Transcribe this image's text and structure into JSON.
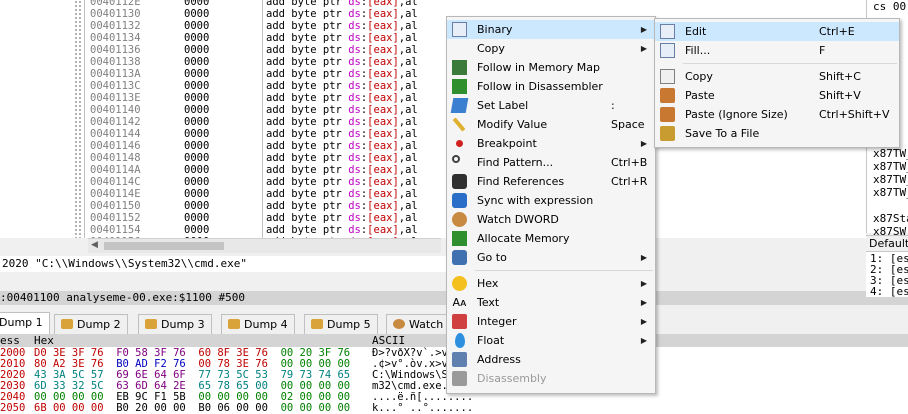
{
  "disasm": {
    "rows": [
      {
        "addr": "0040112E",
        "bytes": "0000",
        "op": "add byte ptr ",
        "seg": "ds",
        "reg": "[eax]",
        "tail": ",al"
      },
      {
        "addr": "00401130",
        "bytes": "0000",
        "op": "add byte ptr ",
        "seg": "ds",
        "reg": "[eax]",
        "tail": ",al"
      },
      {
        "addr": "00401132",
        "bytes": "0000",
        "op": "add byte ptr ",
        "seg": "ds",
        "reg": "[eax]",
        "tail": ",al"
      },
      {
        "addr": "00401134",
        "bytes": "0000",
        "op": "add byte ptr ",
        "seg": "ds",
        "reg": "[eax]",
        "tail": ",al"
      },
      {
        "addr": "00401136",
        "bytes": "0000",
        "op": "add byte ptr ",
        "seg": "ds",
        "reg": "[eax]",
        "tail": ",al"
      },
      {
        "addr": "00401138",
        "bytes": "0000",
        "op": "add byte ptr ",
        "seg": "ds",
        "reg": "[eax]",
        "tail": ",al"
      },
      {
        "addr": "0040113A",
        "bytes": "0000",
        "op": "add byte ptr ",
        "seg": "ds",
        "reg": "[eax]",
        "tail": ",al"
      },
      {
        "addr": "0040113C",
        "bytes": "0000",
        "op": "add byte ptr ",
        "seg": "ds",
        "reg": "[eax]",
        "tail": ",al"
      },
      {
        "addr": "0040113E",
        "bytes": "0000",
        "op": "add byte ptr ",
        "seg": "ds",
        "reg": "[eax]",
        "tail": ",al"
      },
      {
        "addr": "00401140",
        "bytes": "0000",
        "op": "add byte ptr ",
        "seg": "ds",
        "reg": "[eax]",
        "tail": ",al"
      },
      {
        "addr": "00401142",
        "bytes": "0000",
        "op": "add byte ptr ",
        "seg": "ds",
        "reg": "[eax]",
        "tail": ",al"
      },
      {
        "addr": "00401144",
        "bytes": "0000",
        "op": "add byte ptr ",
        "seg": "ds",
        "reg": "[eax]",
        "tail": ",al"
      },
      {
        "addr": "00401146",
        "bytes": "0000",
        "op": "add byte ptr ",
        "seg": "ds",
        "reg": "[eax]",
        "tail": ",al"
      },
      {
        "addr": "00401148",
        "bytes": "0000",
        "op": "add byte ptr ",
        "seg": "ds",
        "reg": "[eax]",
        "tail": ",al"
      },
      {
        "addr": "0040114A",
        "bytes": "0000",
        "op": "add byte ptr ",
        "seg": "ds",
        "reg": "[eax]",
        "tail": ",al"
      },
      {
        "addr": "0040114C",
        "bytes": "0000",
        "op": "add byte ptr ",
        "seg": "ds",
        "reg": "[eax]",
        "tail": ",al"
      },
      {
        "addr": "0040114E",
        "bytes": "0000",
        "op": "add byte ptr ",
        "seg": "ds",
        "reg": "[eax]",
        "tail": ",al"
      },
      {
        "addr": "00401150",
        "bytes": "0000",
        "op": "add byte ptr ",
        "seg": "ds",
        "reg": "[eax]",
        "tail": ",al"
      },
      {
        "addr": "00401152",
        "bytes": "0000",
        "op": "add byte ptr ",
        "seg": "ds",
        "reg": "[eax]",
        "tail": ",al"
      },
      {
        "addr": "00401154",
        "bytes": "0000",
        "op": "add byte ptr ",
        "seg": "ds",
        "reg": "[eax]",
        "tail": ",al"
      },
      {
        "addr": "00401156",
        "bytes": "0000",
        "op": "add byte ptr ",
        "seg": "ds",
        "reg": "[eax]",
        "tail": ",al"
      },
      {
        "addr": "00401158",
        "bytes": "0000",
        "op": "add byte ptr ",
        "seg": "ds",
        "reg": "[eax]",
        "tail": ",al"
      }
    ]
  },
  "info_line": "2020 \"C:\\\\Windows\\\\System32\\\\cmd.exe\"",
  "status_line": ":00401100 analyseme-00.exe:$1100 #500",
  "registers": {
    "top": "cs 00",
    "lines": [
      "x87TW_",
      "x87TW_",
      "x87TW_",
      "x87TW_",
      "",
      "x87Sta",
      "x87SW_",
      "x87CW_"
    ]
  },
  "call_stack": {
    "default_label": "Default",
    "lines": [
      "1: [es",
      "2: [es",
      "3: [es",
      "4: [es"
    ]
  },
  "tabs": [
    {
      "label": "Dump 1",
      "active": true
    },
    {
      "label": "Dump 2",
      "active": false
    },
    {
      "label": "Dump 3",
      "active": false
    },
    {
      "label": "Dump 4",
      "active": false
    },
    {
      "label": "Dump 5",
      "active": false
    },
    {
      "label": "Watch",
      "active": false
    }
  ],
  "dump": {
    "col_addr": "ess",
    "col_hex": "Hex",
    "col_ascii": "ASCII",
    "rows": [
      {
        "addr": "2000",
        "hex": "D0 3E 3F 76  F0 58 3F 76  60 8F 3E 76  00 20 3F 76",
        "ascii": "Ð>?vðX?v`.>v. ?v"
      },
      {
        "addr": "2010",
        "hex": "80 A2 3E 76  B0 AD F2 76  00 78 3E 76  00 00 00 00",
        "ascii": ".¢>v°.òv.x>v...."
      },
      {
        "addr": "2020",
        "hex": "43 3A 5C 57  69 6E 64 6F  77 73 5C 53  79 73 74 65",
        "ascii": "C:\\Windows\\Syste"
      },
      {
        "addr": "2030",
        "hex": "6D 33 32 5C  63 6D 64 2E  65 78 65 00  00 00 00 00",
        "ascii": "m32\\cmd.exe....."
      },
      {
        "addr": "2040",
        "hex": "00 00 00 00  EB 9C F1 5B  00 00 00 00  02 00 00 00",
        "ascii": "....ë.ñ[........"
      },
      {
        "addr": "2050",
        "hex": "6B 00 00 00  B0 20 00 00  B0 06 00 00  00 00 00 00",
        "ascii": "k...° ..°......."
      }
    ]
  },
  "context_menu": {
    "items": [
      {
        "label": "Binary",
        "shortcut": "",
        "submenu": true,
        "icon": "binary-icon"
      },
      {
        "label": "Copy",
        "shortcut": "",
        "submenu": true,
        "icon": ""
      },
      {
        "label": "Follow in Memory Map",
        "shortcut": "",
        "submenu": false,
        "icon": "memory-map-icon"
      },
      {
        "label": "Follow in Disassembler",
        "shortcut": "",
        "submenu": false,
        "icon": "disassembler-icon"
      },
      {
        "label": "Set Label",
        "shortcut": ":",
        "submenu": false,
        "icon": "label-icon"
      },
      {
        "label": "Modify Value",
        "shortcut": "Space",
        "submenu": false,
        "icon": "pencil-icon"
      },
      {
        "label": "Breakpoint",
        "shortcut": "",
        "submenu": true,
        "icon": "breakpoint-icon"
      },
      {
        "label": "Find Pattern...",
        "shortcut": "Ctrl+B",
        "submenu": false,
        "icon": "find-pattern-icon"
      },
      {
        "label": "Find References",
        "shortcut": "Ctrl+R",
        "submenu": false,
        "icon": "binoculars-icon"
      },
      {
        "label": "Sync with expression",
        "shortcut": "",
        "submenu": false,
        "icon": "sync-icon"
      },
      {
        "label": "Watch DWORD",
        "shortcut": "",
        "submenu": false,
        "icon": "watch-dog-icon"
      },
      {
        "label": "Allocate Memory",
        "shortcut": "",
        "submenu": false,
        "icon": "allocate-icon"
      },
      {
        "label": "Go to",
        "shortcut": "",
        "submenu": true,
        "icon": "goto-icon"
      },
      {
        "label": "Hex",
        "shortcut": "",
        "submenu": true,
        "icon": "hex-smiley-icon"
      },
      {
        "label": "Text",
        "shortcut": "",
        "submenu": true,
        "icon": "text-icon"
      },
      {
        "label": "Integer",
        "shortcut": "",
        "submenu": true,
        "icon": "integer-icon"
      },
      {
        "label": "Float",
        "shortcut": "",
        "submenu": true,
        "icon": "float-drop-icon"
      },
      {
        "label": "Address",
        "shortcut": "",
        "submenu": false,
        "icon": "address-icon"
      },
      {
        "label": "Disassembly",
        "shortcut": "",
        "submenu": false,
        "icon": "disassembly-icon",
        "disabled": true
      }
    ]
  },
  "binary_submenu": {
    "items": [
      {
        "label": "Edit",
        "shortcut": "Ctrl+E",
        "icon": "edit-icon"
      },
      {
        "label": "Fill...",
        "shortcut": "F",
        "icon": "fill-icon"
      },
      {
        "label": "Copy",
        "shortcut": "Shift+C",
        "icon": "copy-icon"
      },
      {
        "label": "Paste",
        "shortcut": "Shift+V",
        "icon": "paste-icon"
      },
      {
        "label": "Paste (Ignore Size)",
        "shortcut": "Ctrl+Shift+V",
        "icon": "paste-ignore-size-icon"
      },
      {
        "label": "Save To a File",
        "shortcut": "",
        "icon": "save-file-icon"
      }
    ]
  }
}
